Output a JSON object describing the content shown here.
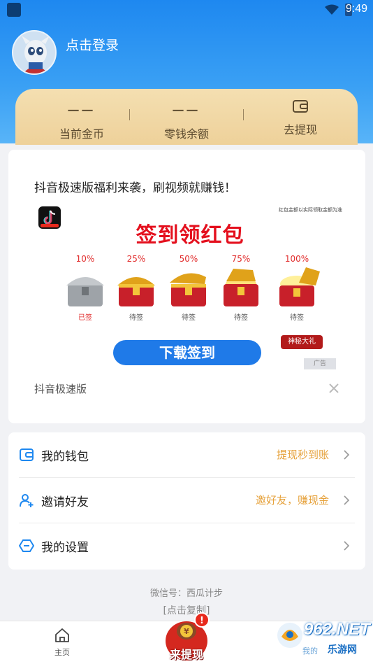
{
  "status_bar": {
    "time": "9:49"
  },
  "profile": {
    "login_text": "点击登录"
  },
  "stats": {
    "coins": {
      "value": "一一",
      "label": "当前金币"
    },
    "balance": {
      "value": "一一",
      "label": "零钱余额"
    },
    "withdraw": {
      "label": "去提现"
    }
  },
  "ad": {
    "title": "抖音极速版福利来袭，刷视频就赚钱！",
    "disclaimer": "红包金额以实际领取金额为准",
    "banner_title": "签到领红包",
    "chests": [
      {
        "percent": "10%",
        "status": "已签"
      },
      {
        "percent": "25%",
        "status": "待签"
      },
      {
        "percent": "50%",
        "status": "待签"
      },
      {
        "percent": "75%",
        "status": "待签"
      },
      {
        "percent": "100%",
        "status": "待签"
      }
    ],
    "mystery_gift": "神秘大礼",
    "download_button": "下载签到",
    "ad_tag": "广告",
    "source": "抖音极速版"
  },
  "menu": {
    "wallet": {
      "label": "我的钱包",
      "hint": "提现秒到账"
    },
    "invite": {
      "label": "邀请好友",
      "hint": "邀好友，赚现金"
    },
    "settings": {
      "label": "我的设置"
    }
  },
  "footer": {
    "wechat": "微信号：西瓜计步",
    "copy": "[点击复制]"
  },
  "bottom_nav": {
    "home": "主页",
    "withdraw": "来提现"
  },
  "watermark": {
    "brand": "962.NET",
    "sub": "乐游网",
    "partial": "我的"
  },
  "colors": {
    "primary": "#1e88f0",
    "gold": "#f4dfb1",
    "hint": "#e6a23c",
    "red": "#e4101e"
  }
}
